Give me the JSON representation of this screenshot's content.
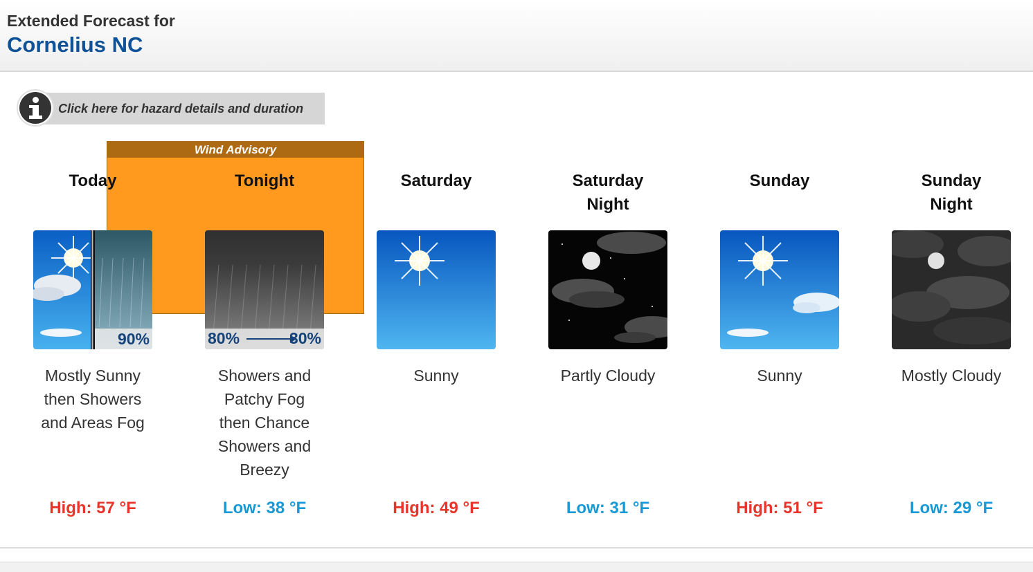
{
  "header": {
    "subtitle": "Extended Forecast for",
    "title": "Cornelius NC"
  },
  "hazard": {
    "button_label": "Click here for hazard details and duration",
    "advisory_label": "Wind Advisory"
  },
  "periods": [
    {
      "name_line1": "Today",
      "name_line2": "",
      "desc_lines": [
        "Mostly Sunny",
        "then Showers",
        "and Areas Fog"
      ],
      "temp": "High: 57 °F",
      "temp_type": "high",
      "icon": "sunny-split-showers-icon",
      "pop": "90%"
    },
    {
      "name_line1": "Tonight",
      "name_line2": "",
      "desc_lines": [
        "Showers and",
        "Patchy Fog",
        "then Chance",
        "Showers and",
        "Breezy"
      ],
      "temp": "Low: 38 °F",
      "temp_type": "low",
      "icon": "showers-icon",
      "pop_start": "80%",
      "pop_end": "30%"
    },
    {
      "name_line1": "Saturday",
      "name_line2": "",
      "desc_lines": [
        "Sunny"
      ],
      "temp": "High: 49 °F",
      "temp_type": "high",
      "icon": "sunny-icon"
    },
    {
      "name_line1": "Saturday",
      "name_line2": "Night",
      "desc_lines": [
        "Partly Cloudy"
      ],
      "temp": "Low: 31 °F",
      "temp_type": "low",
      "icon": "partly-cloudy-night-icon"
    },
    {
      "name_line1": "Sunday",
      "name_line2": "",
      "desc_lines": [
        "Sunny"
      ],
      "temp": "High: 51 °F",
      "temp_type": "high",
      "icon": "sunny-clouds-icon"
    },
    {
      "name_line1": "Sunday",
      "name_line2": "Night",
      "desc_lines": [
        "Mostly Cloudy"
      ],
      "temp": "Low: 29 °F",
      "temp_type": "low",
      "icon": "mostly-cloudy-night-icon"
    }
  ],
  "colors": {
    "title_blue": "#0f5297",
    "high_red": "#e8352a",
    "low_blue": "#1899d5",
    "advisory_orange": "#ff9a1f"
  }
}
